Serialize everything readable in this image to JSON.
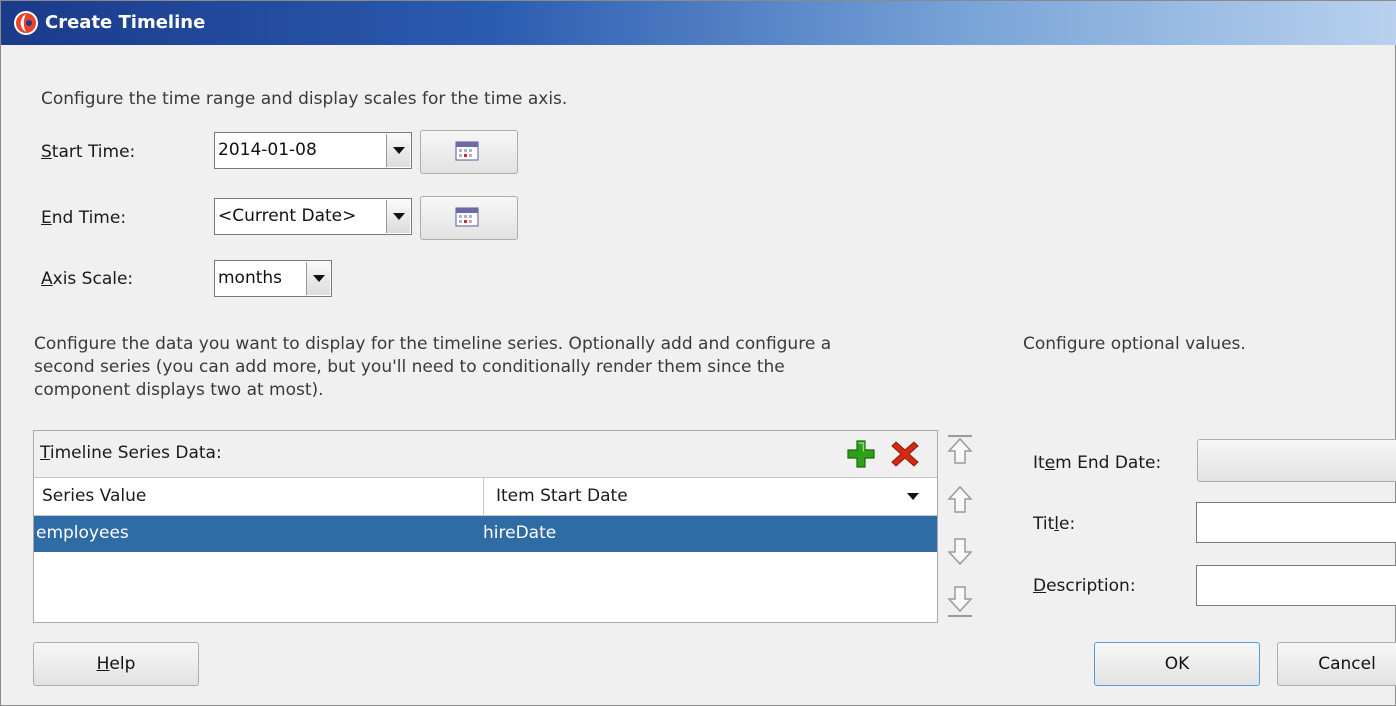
{
  "window": {
    "title": "Create Timeline"
  },
  "time_section": {
    "intro": "Configure the time range and display scales for the time axis.",
    "start_time": {
      "label_mnemonic": "S",
      "label_rest": "tart Time:",
      "value": "2014-01-08"
    },
    "end_time": {
      "label_mnemonic": "E",
      "label_rest": "nd Time:",
      "value": "<Current Date>"
    },
    "axis_scale": {
      "label_mnemonic": "A",
      "label_rest": "xis Scale:",
      "value": "months"
    }
  },
  "series_section": {
    "intro_line1": "Configure the data you want to display for the timeline series. Optionally add and configure a",
    "intro_line2": "second series (you can add more, but you'll need to conditionally render them since the",
    "intro_line3": "component displays two at most).",
    "table_label_mnemonic": "T",
    "table_label_rest": "imeline Series Data:",
    "columns": [
      "Series Value",
      "Item Start Date"
    ],
    "rows": [
      {
        "series_value": "employees",
        "item_start_date": "hireDate"
      }
    ]
  },
  "optional_section": {
    "intro": "Configure optional values.",
    "item_end_date": {
      "label_pre": "It",
      "label_mnemonic": "e",
      "label_rest": "m End Date:",
      "value": ""
    },
    "title": {
      "label_pre": "Tit",
      "label_mnemonic": "l",
      "label_rest": "e:",
      "value": ""
    },
    "description": {
      "label_mnemonic": "D",
      "label_rest": "escription:",
      "value": ""
    }
  },
  "buttons": {
    "help_mnemonic": "H",
    "help_rest": "elp",
    "ok": "OK",
    "cancel": "Cancel"
  },
  "icons": {
    "title": "app-logo-icon",
    "calendar": "calendar-icon",
    "add": "add-icon",
    "remove": "remove-icon",
    "move_top": "move-to-top-icon",
    "move_up": "move-up-icon",
    "move_down": "move-down-icon",
    "move_bottom": "move-to-bottom-icon"
  },
  "colors": {
    "selection": "#2f6ba5",
    "title_bar_start": "#1a3a8a",
    "title_bar_end": "#b9d1ee",
    "add_icon": "#2ea11a",
    "remove_icon": "#d42a0f"
  }
}
